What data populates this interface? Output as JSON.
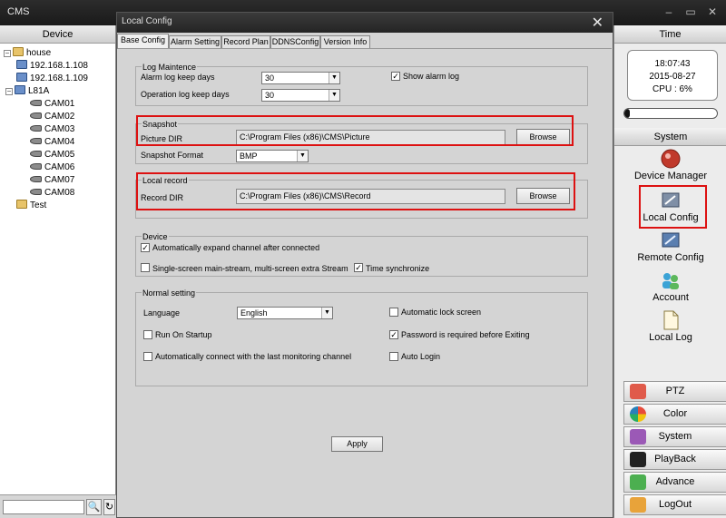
{
  "app": {
    "title": "CMS",
    "min": "–",
    "restore": "▭",
    "close": "✕"
  },
  "left": {
    "header": "Device",
    "tree": [
      {
        "label": "house",
        "kind": "folder"
      },
      {
        "label": "192.168.1.108",
        "kind": "pc"
      },
      {
        "label": "192.168.1.109",
        "kind": "pc"
      },
      {
        "label": "L81A",
        "kind": "pc"
      },
      {
        "label": "CAM01",
        "kind": "cam"
      },
      {
        "label": "CAM02",
        "kind": "cam"
      },
      {
        "label": "CAM03",
        "kind": "cam"
      },
      {
        "label": "CAM04",
        "kind": "cam"
      },
      {
        "label": "CAM05",
        "kind": "cam"
      },
      {
        "label": "CAM06",
        "kind": "cam"
      },
      {
        "label": "CAM07",
        "kind": "cam"
      },
      {
        "label": "CAM08",
        "kind": "cam"
      },
      {
        "label": "Test",
        "kind": "folder"
      }
    ],
    "expander_symbol": "−",
    "search_symbol": "🔍",
    "refresh_symbol": "↻"
  },
  "right": {
    "time_header": "Time",
    "time": "18:07:43",
    "date": "2015-08-27",
    "cpu": "CPU : 6%",
    "cpu_fraction": 0.06,
    "system_header": "System",
    "items": {
      "device_manager": "Device Manager",
      "local_config": "Local Config",
      "remote_config": "Remote Config",
      "account": "Account",
      "local_log": "Local Log"
    },
    "buttons": {
      "ptz": "PTZ",
      "color": "Color",
      "system": "System",
      "playback": "PlayBack",
      "advance": "Advance",
      "logout": "LogOut"
    }
  },
  "dialog": {
    "title": "Local Config",
    "close_symbol": "✕",
    "tabs": [
      "Base Config",
      "Alarm Setting",
      "Record Plan",
      "DDNSConfig",
      "Version Info"
    ],
    "log": {
      "title": "Log Maintence",
      "alarm_label": "Alarm log keep days",
      "alarm_value": "30",
      "operation_label": "Operation log keep days",
      "operation_value": "30",
      "show_alarm_log": "Show alarm log"
    },
    "snapshot": {
      "title": "Snapshot",
      "dir_label": "Picture DIR",
      "dir_value": "C:\\Program Files (x86)\\CMS\\Picture",
      "browse": "Browse",
      "format_label": "Snapshot Format",
      "format_value": "BMP"
    },
    "record": {
      "title": "Local record",
      "dir_label": "Record DIR",
      "dir_value": "C:\\Program Files (x86)\\CMS\\Record",
      "browse": "Browse"
    },
    "device": {
      "title": "Device",
      "auto_expand": "Automatically expand channel after connected",
      "single_screen": "Single-screen main-stream, multi-screen extra Stream",
      "time_sync": "Time synchronize"
    },
    "normal": {
      "title": "Normal setting",
      "language_label": "Language",
      "language_value": "English",
      "run_on_startup": "Run On Startup",
      "auto_connect": "Automatically connect with the last monitoring channel",
      "auto_lock": "Automatic lock screen",
      "password_exit": "Password is required before Exiting",
      "auto_login": "Auto Login"
    },
    "apply": "Apply",
    "check_mark": "✓",
    "dropdown_arrow": "▼"
  }
}
